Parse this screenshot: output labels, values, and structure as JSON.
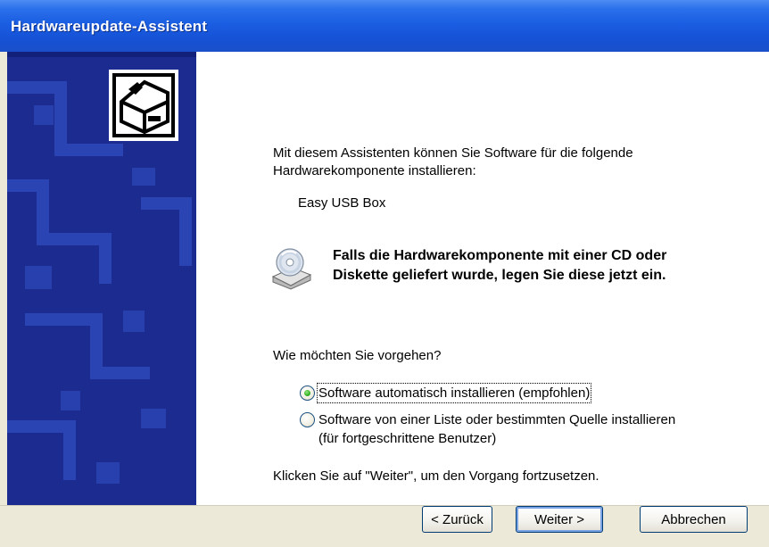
{
  "window": {
    "title": "Hardwareupdate-Assistent"
  },
  "intro": {
    "line1": "Mit diesem Assistenten können Sie Software für die folgende",
    "line2": "Hardwarekomponente installieren:"
  },
  "device_name": "Easy USB Box",
  "cd_notice": {
    "icon": "cd-drive-icon",
    "line1": "Falls die Hardwarekomponente mit einer CD oder",
    "line2": "Diskette geliefert wurde, legen Sie diese jetzt ein."
  },
  "question": "Wie möchten Sie vorgehen?",
  "options": [
    {
      "label": "Software automatisch installieren (empfohlen)",
      "selected": true
    },
    {
      "label": "Software von einer Liste oder bestimmten Quelle installieren",
      "label2": "(für fortgeschrittene Benutzer)",
      "selected": false
    }
  ],
  "continue_hint": "Klicken Sie auf \"Weiter\", um den Vorgang fortzusetzen.",
  "buttons": {
    "back": "< Zurück",
    "next": "Weiter >",
    "cancel": "Abbrechen"
  },
  "colors": {
    "titlebar": "#1552d6",
    "sidepanel": "#1a2a8a",
    "radio_selected": "#29a81c"
  }
}
